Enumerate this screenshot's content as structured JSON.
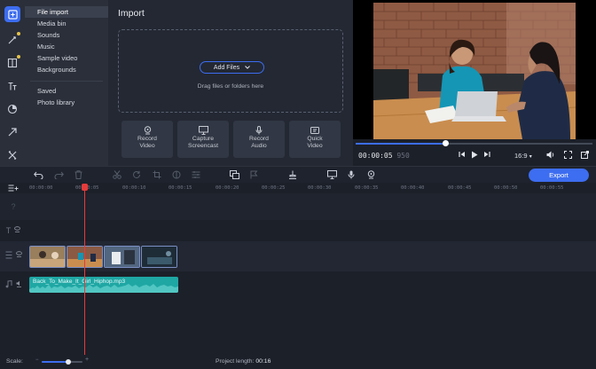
{
  "sidebar": {
    "tools": [
      {
        "name": "import-icon",
        "active": true
      },
      {
        "name": "magic-wand-icon",
        "active": false,
        "badge": true
      },
      {
        "name": "transitions-icon",
        "active": false,
        "badge": true
      },
      {
        "name": "titles-icon",
        "active": false
      },
      {
        "name": "filters-icon",
        "active": false
      },
      {
        "name": "motion-icon",
        "active": false
      },
      {
        "name": "more-tools-icon",
        "active": false
      }
    ],
    "categories": [
      "File import",
      "Media bin",
      "Sounds",
      "Music",
      "Sample video",
      "Backgrounds"
    ],
    "categories2": [
      "Saved",
      "Photo library"
    ]
  },
  "import": {
    "title": "Import",
    "add_files": "Add Files",
    "drop_hint": "Drag files or folders here",
    "actions": [
      {
        "line1": "Record",
        "line2": "Video",
        "icon": "webcam-icon"
      },
      {
        "line1": "Capture",
        "line2": "Screencast",
        "icon": "monitor-icon"
      },
      {
        "line1": "Record",
        "line2": "Audio",
        "icon": "microphone-icon"
      },
      {
        "line1": "Quick",
        "line2": "Video",
        "icon": "quick-video-icon"
      }
    ]
  },
  "player": {
    "time_current": "00:00:05",
    "time_frames": "950",
    "aspect": "16:9",
    "progress": 0.38
  },
  "toolbar": {
    "export_label": "Export"
  },
  "ruler": {
    "ticks": [
      "00:00:00",
      "00:00:05",
      "00:00:10",
      "00:00:15",
      "00:00:20",
      "00:00:25",
      "00:00:30",
      "00:00:35",
      "00:00:40",
      "00:00:45",
      "00:00:50",
      "00:00:55"
    ]
  },
  "audio_track": {
    "file_name": "Back_To_Make_It_Girl_Hiphop.mp3"
  },
  "footer": {
    "scale_label": "Scale:",
    "project_length_label": "Project length:",
    "project_length": "00:16",
    "scale_level": 0.65
  },
  "colors": {
    "accent": "#3d6df0",
    "playhead": "#e53b3b",
    "audio": "#1fa7a4"
  }
}
